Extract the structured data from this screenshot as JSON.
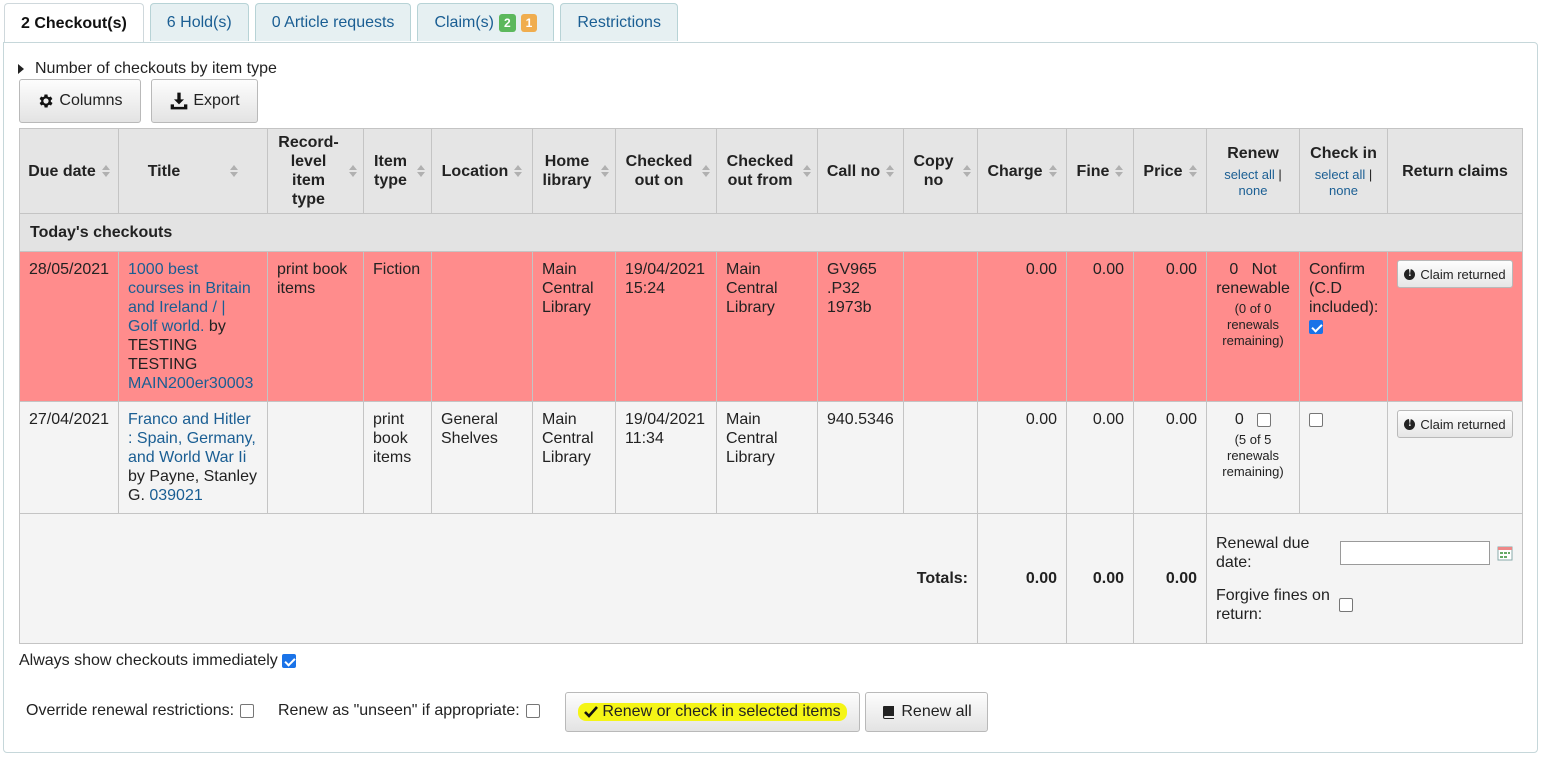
{
  "tabs": {
    "checkouts": "2 Checkout(s)",
    "holds": "6 Hold(s)",
    "article_requests": "0 Article requests",
    "claims": "Claim(s)",
    "claims_badge_resolved": "2",
    "claims_badge_unresolved": "1",
    "restrictions": "Restrictions"
  },
  "summary_toggle": "Number of checkouts by item type",
  "toolbar": {
    "columns": "Columns",
    "export": "Export"
  },
  "headers": {
    "due_date": "Due date",
    "title": "Title",
    "record_item_type": "Record-level item type",
    "item_type": "Item type",
    "location": "Location",
    "home_library": "Home library",
    "checked_out_on": "Checked out on",
    "checked_out_from": "Checked out from",
    "call_no": "Call no",
    "copy_no": "Copy no",
    "charge": "Charge",
    "fine": "Fine",
    "price": "Price",
    "renew": "Renew",
    "renew_select_all": "select all",
    "renew_none": "none",
    "check_in": "Check in",
    "checkin_select_all": "select all",
    "checkin_none": "none",
    "return_claims": "Return claims"
  },
  "group_label": "Today's checkouts",
  "rows": [
    {
      "due_date": "28/05/2021",
      "title": "1000 best courses in Britain and Ireland / | Golf world.",
      "by": "by TESTING TESTING",
      "barcode": "MAIN200er30003",
      "record_item_type": "print book items",
      "item_type": "Fiction",
      "location": "",
      "home_library": "Main Central Library",
      "checked_out_on": "19/04/2021 15:24",
      "checked_out_from": "Main Central Library",
      "call_no": "GV965 .P32 1973b",
      "copy_no": "",
      "charge": "0.00",
      "fine": "0.00",
      "price": "0.00",
      "renew_count": "0",
      "renew_status": "Not renewable",
      "renew_remaining": "(0 of 0 renewals remaining)",
      "checkin_text": "Confirm (C.D included):",
      "claim_button": "Claim returned"
    },
    {
      "due_date": "27/04/2021",
      "title": "Franco and Hitler : Spain, Germany, and World War Ii",
      "by": "by Payne, Stanley G.",
      "barcode": "039021",
      "record_item_type": "",
      "item_type": "print book items",
      "location": "General Shelves",
      "home_library": "Main Central Library",
      "checked_out_on": "19/04/2021 11:34",
      "checked_out_from": "Main Central Library",
      "call_no": "940.5346",
      "copy_no": "",
      "charge": "0.00",
      "fine": "0.00",
      "price": "0.00",
      "renew_count": "0",
      "renew_remaining": "(5 of 5 renewals remaining)",
      "claim_button": "Claim returned"
    }
  ],
  "totals": {
    "label": "Totals:",
    "charge": "0.00",
    "fine": "0.00",
    "price": "0.00",
    "renewal_due_date_label": "Renewal due date:",
    "renewal_due_date_value": "",
    "forgive_fines_label": "Forgive fines on return:"
  },
  "always_show": "Always show checkouts immediately",
  "bottom": {
    "override_label": "Override renewal restrictions:",
    "unseen_label": "Renew as \"unseen\" if appropriate:",
    "renew_checkin_button": "Renew or check in selected items",
    "renew_all_button": "Renew all"
  },
  "colors": {
    "overdue_row": "#ff8c8c",
    "link": "#1a5e93",
    "highlight": "#f5f516"
  }
}
